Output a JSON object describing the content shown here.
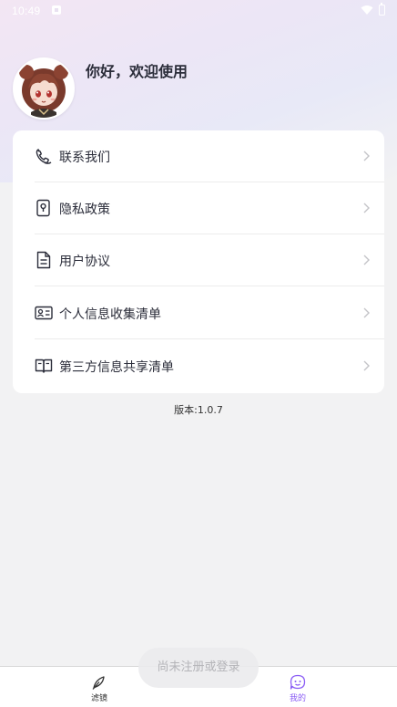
{
  "status_bar": {
    "time": "10:49"
  },
  "profile": {
    "greeting": "你好，欢迎使用"
  },
  "menu": {
    "items": [
      {
        "label": "联系我们",
        "icon": "phone-icon"
      },
      {
        "label": "隐私政策",
        "icon": "privacy-lock-icon"
      },
      {
        "label": "用户协议",
        "icon": "document-icon"
      },
      {
        "label": "个人信息收集清单",
        "icon": "id-card-icon"
      },
      {
        "label": "第三方信息共享清单",
        "icon": "open-book-icon"
      }
    ]
  },
  "version": "版本:1.0.7",
  "toast": "尚未注册或登录",
  "bottom_nav": {
    "items": [
      {
        "label": "滤镜",
        "icon": "feather-icon",
        "active": false
      },
      {
        "label": "我的",
        "icon": "profile-bubble-icon",
        "active": true
      }
    ]
  },
  "colors": {
    "accent": "#8a5cf5",
    "background": "#f2f2f3"
  }
}
